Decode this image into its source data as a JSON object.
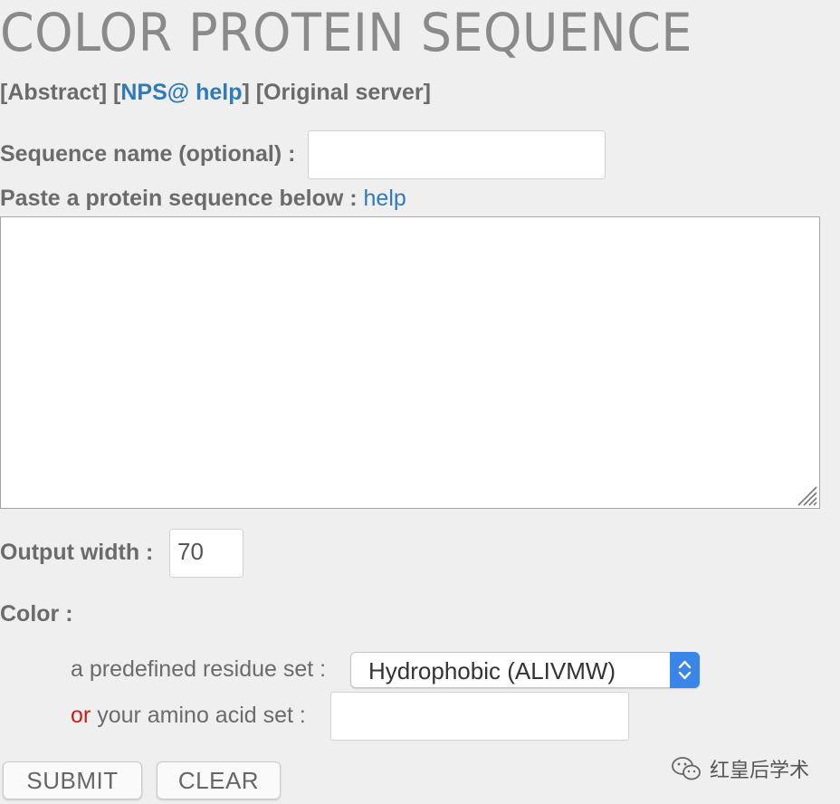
{
  "title": "COLOR PROTEIN SEQUENCE",
  "links": {
    "open1": "[",
    "abstract": "Abstract",
    "close1": "] [",
    "nps_help": "NPS@ help",
    "close2": "] [",
    "original": "Original server",
    "close3": "]"
  },
  "seqname": {
    "label": "Sequence name (optional) :",
    "value": ""
  },
  "paste": {
    "label": "Paste a protein sequence below :",
    "help": "help",
    "value": ""
  },
  "output_width": {
    "label": "Output width :",
    "value": "70"
  },
  "color": {
    "label": "Color :",
    "predefined_label": "a predefined residue set :",
    "predefined_selected": "Hydrophobic (ALIVMW)",
    "or": "or",
    "own_label": "your amino acid set :",
    "own_value": ""
  },
  "buttons": {
    "submit": "SUBMIT",
    "clear": "CLEAR"
  },
  "watermark": {
    "text": "红皇后学术",
    "icon": "wechat-icon"
  },
  "colors": {
    "link": "#2f7ab9",
    "or_red": "#cc1b1b",
    "select_accent": "#3a86e8"
  }
}
